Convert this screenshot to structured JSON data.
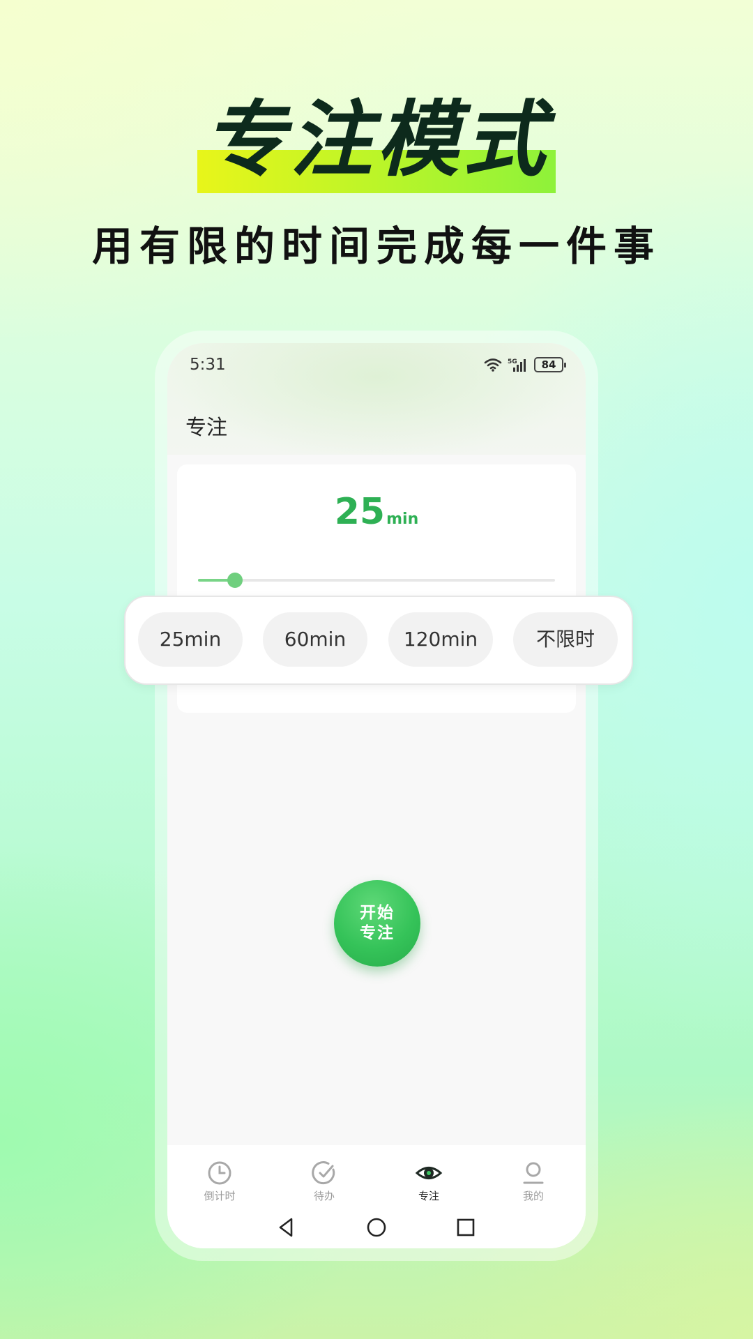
{
  "hero": {
    "title": "专注模式",
    "subtitle": "用有限的时间完成每一件事"
  },
  "status_bar": {
    "time": "5:31",
    "network": "5G",
    "battery": "84"
  },
  "screen": {
    "title": "专注"
  },
  "focus": {
    "duration_value": "25",
    "duration_unit": "min",
    "slider_fraction": 0.104,
    "presets": [
      "25min",
      "60min",
      "120min",
      "不限时"
    ],
    "start_line1": "开始",
    "start_line2": "专注"
  },
  "bottom_nav": {
    "items": [
      {
        "label": "倒计时",
        "icon": "clock-icon"
      },
      {
        "label": "待办",
        "icon": "check-circle-icon"
      },
      {
        "label": "专注",
        "icon": "eye-icon",
        "active": true
      },
      {
        "label": "我的",
        "icon": "user-icon"
      }
    ]
  },
  "system_nav": [
    "back-icon",
    "home-icon",
    "recents-icon"
  ],
  "colors": {
    "accent_green": "#2eb054",
    "headline": "#0d2a1c",
    "highlight_start": "#e8f51a",
    "highlight_end": "#8ef23a"
  }
}
